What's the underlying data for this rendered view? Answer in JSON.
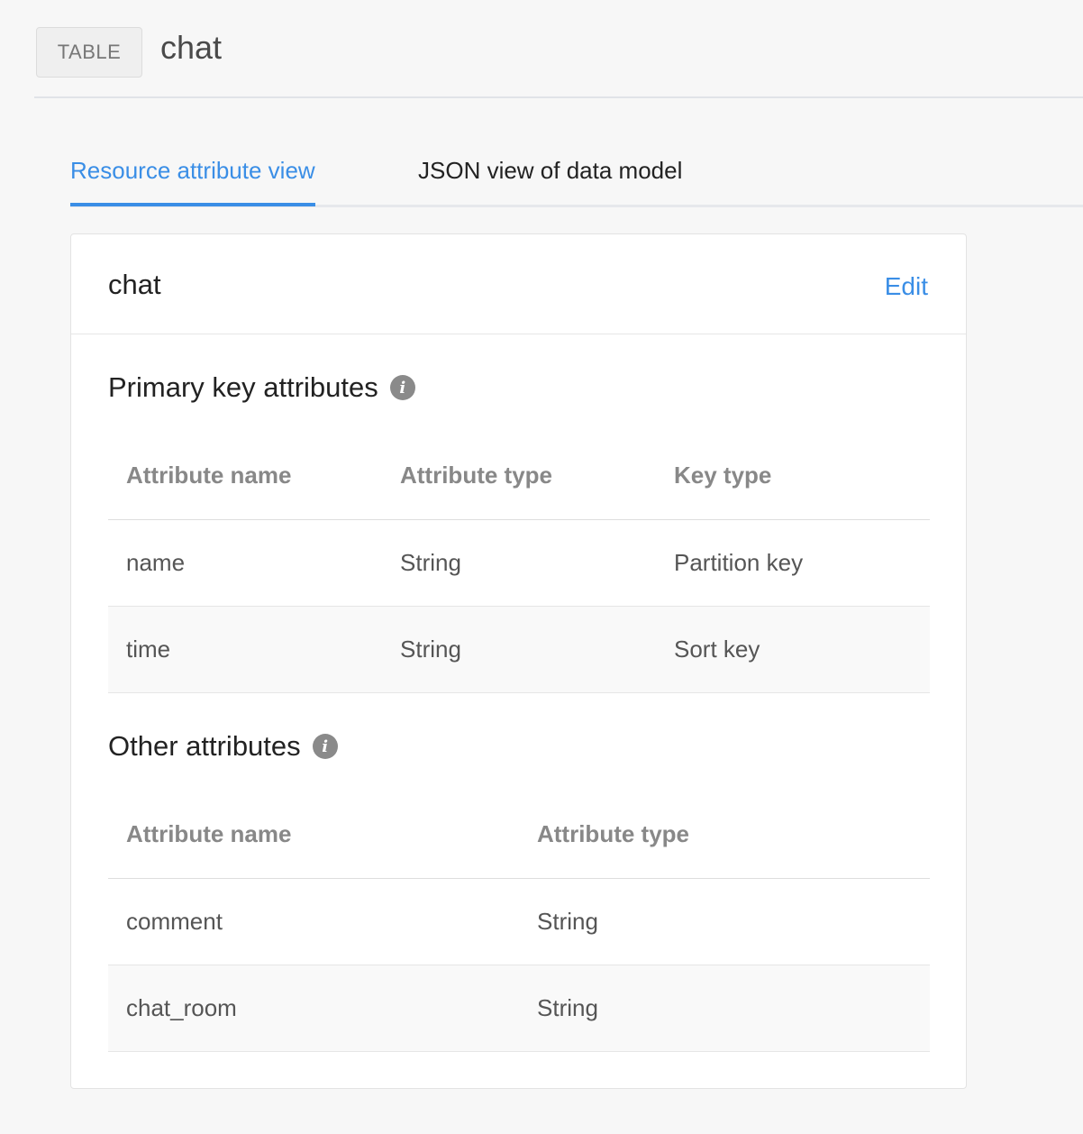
{
  "header": {
    "badge": "TABLE",
    "title": "chat"
  },
  "tabs": [
    {
      "label": "Resource attribute view",
      "active": true
    },
    {
      "label": "JSON view of data model",
      "active": false
    }
  ],
  "card": {
    "title": "chat",
    "edit_label": "Edit"
  },
  "primary": {
    "title": "Primary key attributes",
    "columns": [
      "Attribute name",
      "Attribute type",
      "Key type"
    ],
    "rows": [
      [
        "name",
        "String",
        "Partition key"
      ],
      [
        "time",
        "String",
        "Sort key"
      ]
    ]
  },
  "other": {
    "title": "Other attributes",
    "columns": [
      "Attribute name",
      "Attribute type"
    ],
    "rows": [
      [
        "comment",
        "String"
      ],
      [
        "chat_room",
        "String"
      ]
    ]
  },
  "icons": {
    "info": "info-icon",
    "info_glyph": "i"
  },
  "colors": {
    "accent": "#3a8ee6",
    "icon_gray": "#8a8a8a"
  }
}
